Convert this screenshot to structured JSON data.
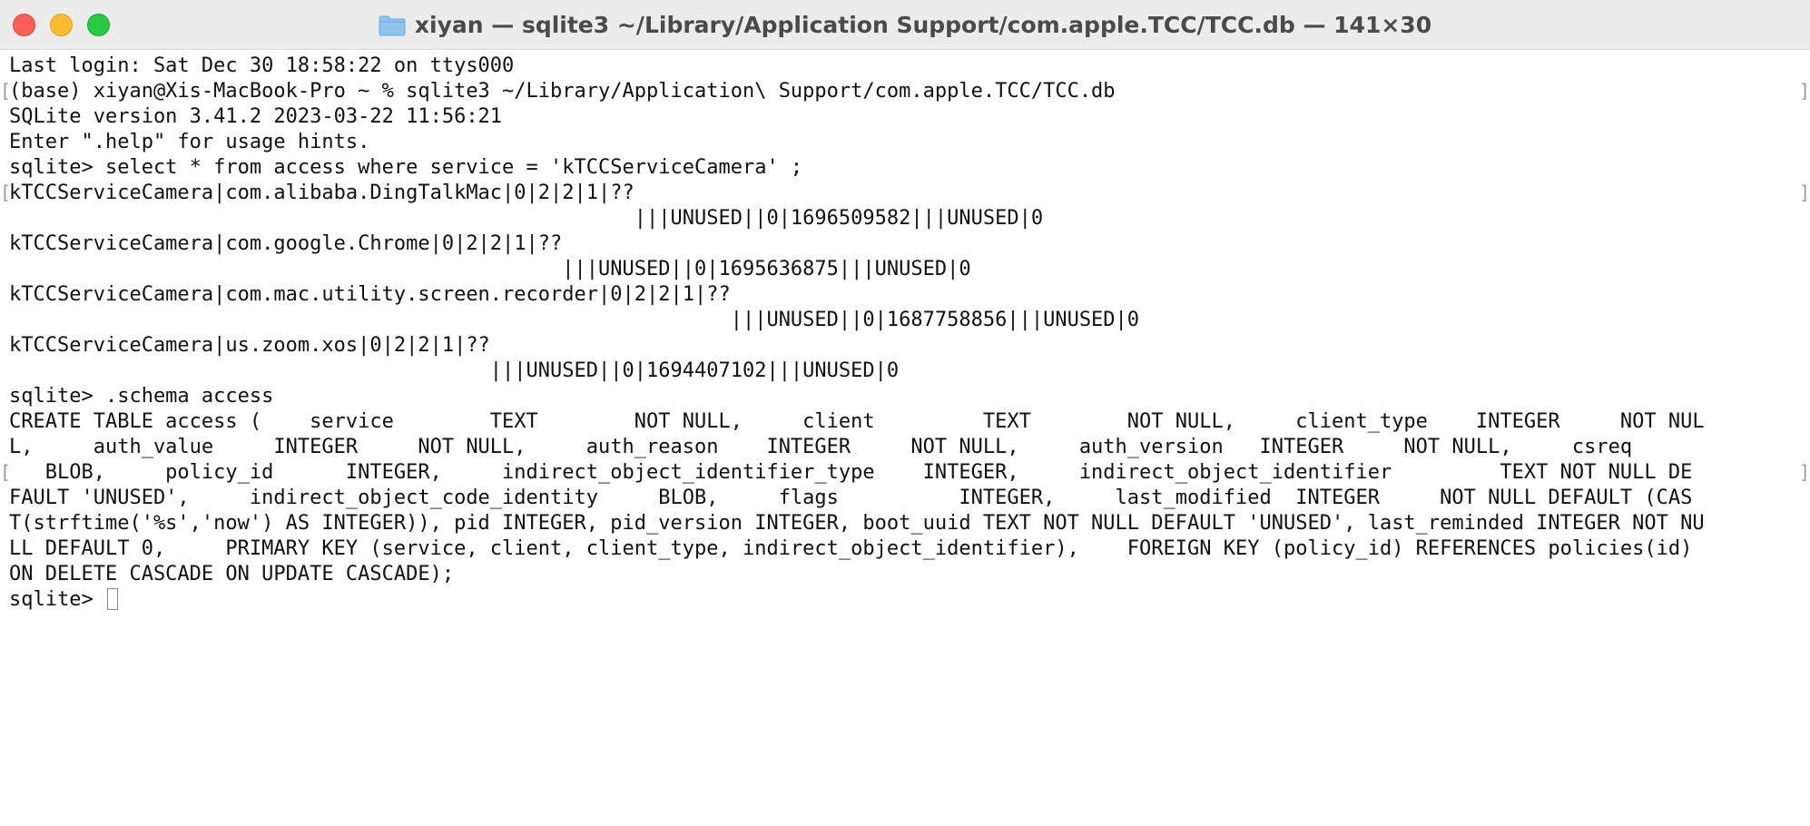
{
  "window": {
    "title": "xiyan — sqlite3 ~/Library/Application Support/com.apple.TCC/TCC.db — 141×30",
    "folder_icon": "folder-icon",
    "buttons": {
      "close_icon": "close-icon",
      "minimize_icon": "minimize-icon",
      "maximize_icon": "maximize-icon"
    }
  },
  "terminal": {
    "lines": [
      "Last login: Sat Dec 30 18:58:22 on ttys000",
      "(base) xiyan@Xis-MacBook-Pro ~ % sqlite3 ~/Library/Application\\ Support/com.apple.TCC/TCC.db",
      "SQLite version 3.41.2 2023-03-22 11:56:21",
      "Enter \".help\" for usage hints.",
      "sqlite> select * from access where service = 'kTCCServiceCamera' ;",
      "kTCCServiceCamera|com.alibaba.DingTalkMac|0|2|2|1|??",
      "                                                    |||UNUSED||0|1696509582|||UNUSED|0",
      "kTCCServiceCamera|com.google.Chrome|0|2|2|1|??",
      "                                              |||UNUSED||0|1695636875|||UNUSED|0",
      "kTCCServiceCamera|com.mac.utility.screen.recorder|0|2|2|1|??",
      "                                                            |||UNUSED||0|1687758856|||UNUSED|0",
      "kTCCServiceCamera|us.zoom.xos|0|2|2|1|??",
      "                                        |||UNUSED||0|1694407102|||UNUSED|0",
      "sqlite> .schema access",
      "CREATE TABLE access (    service        TEXT        NOT NULL,     client         TEXT        NOT NULL,     client_type    INTEGER     NOT NUL",
      "L,     auth_value     INTEGER     NOT NULL,     auth_reason    INTEGER     NOT NULL,     auth_version   INTEGER     NOT NULL,     csreq",
      "   BLOB,     policy_id      INTEGER,     indirect_object_identifier_type    INTEGER,     indirect_object_identifier         TEXT NOT NULL DE",
      "FAULT 'UNUSED',     indirect_object_code_identity     BLOB,     flags          INTEGER,     last_modified  INTEGER     NOT NULL DEFAULT (CAS",
      "T(strftime('%s','now') AS INTEGER)), pid INTEGER, pid_version INTEGER, boot_uuid TEXT NOT NULL DEFAULT 'UNUSED', last_reminded INTEGER NOT NU",
      "LL DEFAULT 0,     PRIMARY KEY (service, client, client_type, indirect_object_identifier),    FOREIGN KEY (policy_id) REFERENCES policies(id)",
      "ON DELETE CASCADE ON UPDATE CASCADE);"
    ],
    "prompt": "sqlite> "
  }
}
